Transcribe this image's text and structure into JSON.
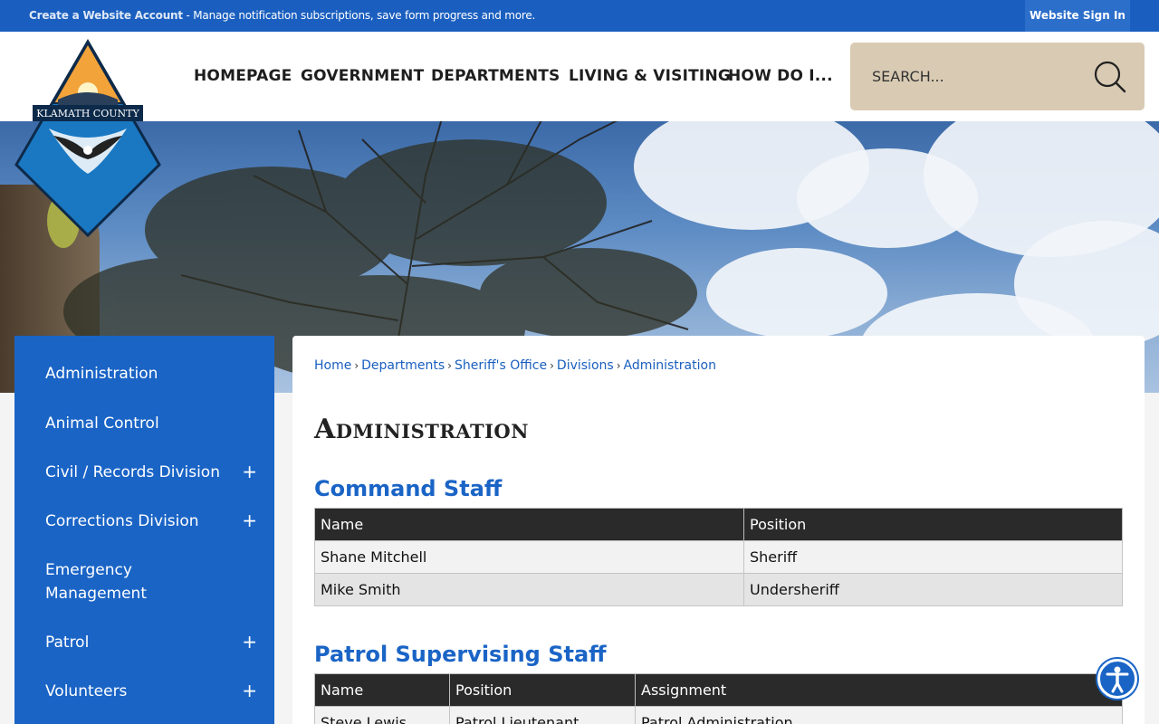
{
  "topbar": {
    "create_account": "Create a Website Account",
    "message": " - Manage notification subscriptions, save form progress and more.",
    "signin": "Website Sign In"
  },
  "logo": {
    "text": "KLAMATH COUNTY"
  },
  "nav": [
    {
      "label": "HOMEPAGE"
    },
    {
      "label": "GOVERNMENT"
    },
    {
      "label": "DEPARTMENTS"
    },
    {
      "label": "LIVING & VISITING"
    },
    {
      "label": "HOW DO I..."
    }
  ],
  "search": {
    "placeholder": "SEARCH..."
  },
  "sidebar": {
    "items": [
      {
        "label": "Administration",
        "expandable": false
      },
      {
        "label": "Animal Control",
        "expandable": false
      },
      {
        "label": "Civil / Records Division",
        "expandable": true
      },
      {
        "label": "Corrections Division",
        "expandable": true
      },
      {
        "label": "Emergency Management",
        "expandable": false
      },
      {
        "label": "Patrol",
        "expandable": true
      },
      {
        "label": "Volunteers",
        "expandable": true
      }
    ],
    "plus": "+"
  },
  "breadcrumb": [
    "Home",
    "Departments",
    "Sheriff's Office",
    "Divisions",
    "Administration"
  ],
  "breadcrumb_sep": "›",
  "page_title": "Administration",
  "command_staff": {
    "title": "Command Staff",
    "headers": [
      "Name",
      "Position"
    ],
    "rows": [
      [
        "Shane Mitchell",
        "Sheriff"
      ],
      [
        "Mike Smith",
        "Undersheriff"
      ]
    ]
  },
  "patrol_staff": {
    "title": "Patrol Supervising Staff",
    "headers": [
      "Name",
      "Position",
      "Assignment"
    ],
    "rows": [
      [
        "Steve Lewis",
        "Patrol Lieutenant",
        "Patrol Administration"
      ]
    ]
  },
  "colors": {
    "primary": "#1a64c6",
    "topbar": "#1a5fbf",
    "search_bg": "#d9cbb3",
    "table_header": "#2a2a2a"
  }
}
